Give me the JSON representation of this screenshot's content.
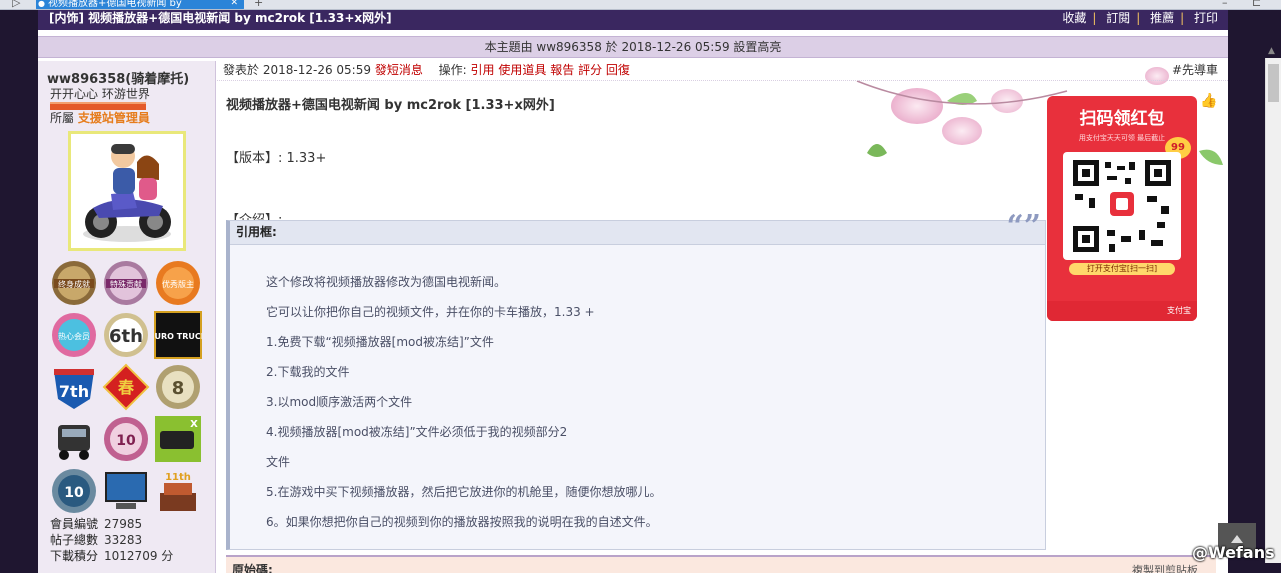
{
  "browser": {
    "tab_title": "视频播放器+德国电视新闻 by",
    "nav_glyph": "▷",
    "close_glyph": "✕",
    "new_tab_glyph": "+",
    "minimize_glyph": "–",
    "restore_glyph": "⊏"
  },
  "topic": {
    "title": "[内饰] 视频播放器+德国电视新闻 by mc2rok [1.33+x网外]",
    "actions": [
      "收藏",
      "訂閱",
      "推薦",
      "打印"
    ]
  },
  "highlight": {
    "text": "本主題由 ww896358 於 2018-12-26 05:59 設置高亮"
  },
  "user": {
    "name": "ww896358(骑着摩托)",
    "signature": "开开心心 环游世界",
    "group_label": "所屬",
    "group_name": "支援站管理員",
    "medals": [
      {
        "icon": "medal-lifetime-achievement",
        "text": "终身成就"
      },
      {
        "icon": "medal-special-contribution",
        "text": "特殊贡献"
      },
      {
        "icon": "medal-excellent-moderator",
        "text": "优秀版主"
      },
      {
        "icon": "medal-enthusiastic-member",
        "text": "热心会员"
      },
      {
        "icon": "medal-6th-anniversary",
        "text": "6th"
      },
      {
        "icon": "medal-euro-truck",
        "text": "EURO TRUCK"
      },
      {
        "icon": "medal-7th-anniversary",
        "text": "7th"
      },
      {
        "icon": "medal-spring",
        "text": "春"
      },
      {
        "icon": "medal-8th-anniversary",
        "text": "8"
      },
      {
        "icon": "medal-truck",
        "text": ""
      },
      {
        "icon": "medal-10th-anniversary-pink",
        "text": "10"
      },
      {
        "icon": "medal-bus",
        "text": "X"
      },
      {
        "icon": "medal-10th-anniversary-blue",
        "text": "10"
      },
      {
        "icon": "medal-computer",
        "text": ""
      },
      {
        "icon": "medal-11th-cake",
        "text": "11th"
      }
    ],
    "stats": [
      {
        "label": "會員編號",
        "value": "27985"
      },
      {
        "label": "帖子總數",
        "value": "33283"
      },
      {
        "label": "下載積分",
        "value": "1012709 分"
      }
    ]
  },
  "post": {
    "posted_label": "發表於",
    "posted_time": "2018-12-26 05:59",
    "short_msg": "發短消息",
    "ops_label": "操作:",
    "ops": [
      "引用",
      "使用道具",
      "報告",
      "評分",
      "回復"
    ],
    "floor": "#先導車",
    "title": "视频播放器+德国电视新闻 by mc2rok [1.33+x网外]",
    "version_line": "【版本】: 1.33+",
    "intro_line": "【介绍】:",
    "quote_header": "引用框:",
    "quote_mark": "“”",
    "quote_items": [
      "这个修改将视频播放器修改为德国电视新闻。",
      "它可以让你把你自己的视频文件，并在你的卡车播放，1.33 +",
      "1.免费下载“视频播放器[mod被冻结]”文件",
      "2.下载我的文件",
      "3.以mod顺序激活两个文件",
      "4.视频播放器[mod被冻结]”文件必须低于我的视频部分2",
      "文件",
      "5.在游戏中买下视频播放器，然后把它放进你的机舱里，随便你想放哪儿。",
      "6。如果你想把你自己的视频到你的播放器按照我的说明在我的自述文件。"
    ],
    "next_label": "原始碼:",
    "next_right": "複製到剪貼板"
  },
  "ad": {
    "title": "扫码领红包",
    "subtitle": "用支付宝天天可领 最后截止",
    "badge": "99",
    "button": "打开支付宝[扫一扫]",
    "brand": "支付宝"
  },
  "watermark": "@Wefans",
  "colors": {
    "topic_bar": "#3a2760",
    "accent_red": "#c00000",
    "group_orange": "#e67c1c",
    "ad_red": "#e8303c"
  }
}
